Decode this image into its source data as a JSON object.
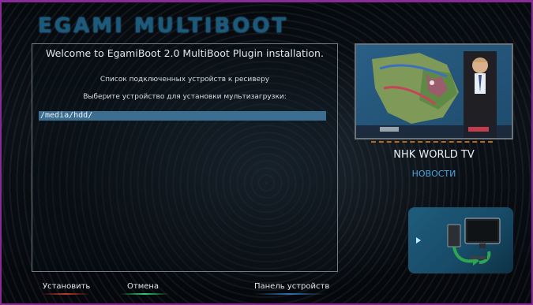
{
  "app": {
    "title": "EGAMI MULTIBOOT"
  },
  "main": {
    "welcome": "Welcome to EgamiBoot 2.0 MultiBoot Plugin installation.",
    "devices_list_label": "Список подключенных устройств к ресиверу",
    "choose_label": "Выберите устройство для установки мультизагрузки:",
    "selected_device": "/media/hdd/"
  },
  "preview": {
    "channel": "NHK WORLD TV",
    "category": "НОВОСТИ"
  },
  "footer": {
    "install_label": "Установить",
    "cancel_label": "Отмена",
    "device_panel_label": "Панель устройств",
    "colors": {
      "red": "#c0392b",
      "green": "#2ecc71",
      "blue": "#2f6fb5"
    }
  },
  "icons": [
    "device-panel-icon",
    "pc-icon",
    "arrow-right-icon"
  ]
}
